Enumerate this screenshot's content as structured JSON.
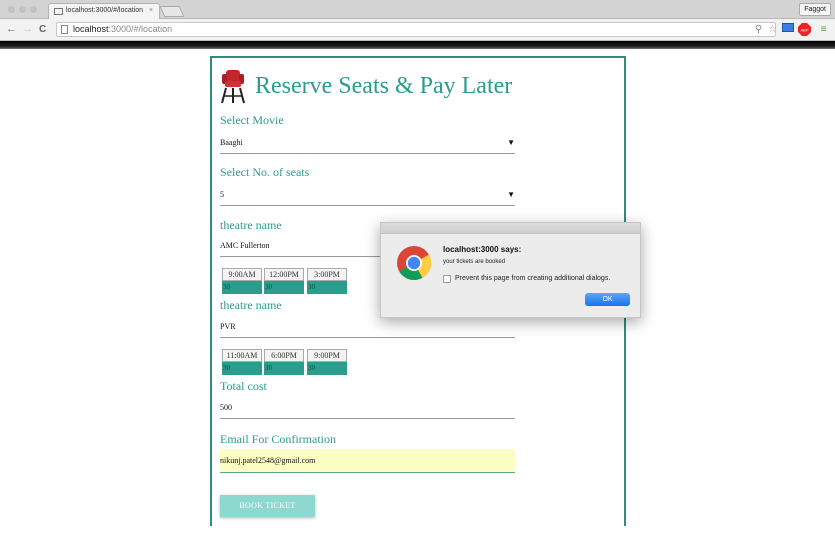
{
  "browser": {
    "tab_title": "localhost:3000/#/location",
    "tab_close": "×",
    "profile_name": "Faggot",
    "url_host": "localhost",
    "url_path": ":3000/#/location",
    "back": "←",
    "forward": "→",
    "reload": "C",
    "extension_badge": "ABP"
  },
  "app": {
    "title": "Reserve Seats & Pay Later",
    "movie": {
      "label": "Select Movie",
      "value": "Baaghi"
    },
    "seats": {
      "label": "Select No. of seats",
      "value": "5"
    },
    "caret": "▼",
    "theatres": [
      {
        "label": "theatre name",
        "name": "AMC Fullerton",
        "shows": [
          {
            "time": "9:00AM",
            "seats": "30"
          },
          {
            "time": "12:00PM",
            "seats": "30"
          },
          {
            "time": "3:00PM",
            "seats": "30"
          }
        ]
      },
      {
        "label": "theatre name",
        "name": "PVR",
        "shows": [
          {
            "time": "11:00AM",
            "seats": "30"
          },
          {
            "time": "6:00PM",
            "seats": "30"
          },
          {
            "time": "9:00PM",
            "seats": "30"
          }
        ]
      }
    ],
    "total": {
      "label": "Total cost",
      "value": "500"
    },
    "email": {
      "label": "Email For Confirmation",
      "value": "nikunj.patel2548@gmail.com"
    },
    "book_label": "BOOK TICKET"
  },
  "dialog": {
    "title": "localhost:3000 says:",
    "message": "your tickets are booked",
    "checkbox_label": "Prevent this page from creating additional dialogs.",
    "ok_label": "OK"
  },
  "colors": {
    "accent": "#2d9b8e",
    "seat_bar": "#2a9d8c",
    "button": "#8dd8cf",
    "email_bg": "#fbffc4"
  }
}
